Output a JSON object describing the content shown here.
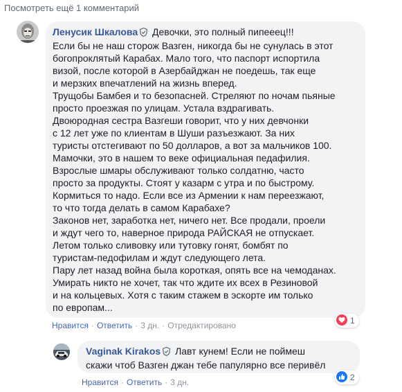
{
  "more_comments": "Посмотреть ещё 1 комментарий",
  "comments": [
    {
      "author": "Ленусик Шкалова",
      "first_line": "Девочки, это полный пипееец!!!",
      "paragraphs": [
        "Если бы не наш сторож Вазген, никогда бы не сунулась в этот\nбогопроклятый Карабах. Мало того, что паспорт испортила\nвизой, после которой в Азербайджан не поедешь, так еще\nи мерзких впечатлений на жизнь вперед.",
        "Трущобы Бамбея и то безопасней. Стреляют по ночам пьяные\nпросто проезжая по улицам. Устала вздрагивать.",
        "Двоюродная сестра Вазгеши говорит, что у них девчонки\nс 12 лет уже по клиентам в Шуши разъезжают. За них\nтуристы отстегивают по 50 долларов, а вот за мальчиков 100.\nМамочки, это в нашем то веке официальная педафилия.",
        "Взрослые шмары обслуживают только солдатню, часто\nпросто за продукты. Стоят у казарм с утра и по быстрому.\nКормиться то надо. Если все из Армении к нам переезжают,\nто что тогда делать в самом Карабахе?",
        "Законов нет, заработка нет, ничего нет. Все продали, проели\nи ждут чего то, наверное природа РАЙСКАЯ не отпускает.",
        "Летом только сливовку или тутовку гонят, бомбят по\nтуристам-педофилам и ждут следующего лета.",
        "Пару лет назад война была короткая, опять все на чемоданах.\nУмирать никто не хочет, так что ждите их всех в Резиновой\nи на кольцевых. Хотя с таким стажем в эскорте им только\nпо европам..."
      ],
      "actions": {
        "like": "Нравится",
        "reply": "Ответить",
        "time": "3 дн.",
        "edited": "Отредактировано"
      },
      "reactions": {
        "count": "1",
        "icon": "love-reaction-icon",
        "color": "#f33e58"
      }
    },
    {
      "author": "Vaginak Kirakos",
      "first_line": "Лавт кунем! Если не поймеш",
      "paragraphs": [
        "скажи чтоб Вазген джан тебе папулярно все перивёл"
      ],
      "actions": {
        "like": "Нравится",
        "reply": "Ответить",
        "time": "3 дн."
      },
      "reactions": {
        "count": "2",
        "icon": "like-reaction-icon",
        "color": "#1877f2"
      }
    }
  ],
  "separator": "·",
  "colors": {
    "link": "#385898",
    "meta": "#90949c",
    "bubble": "#f2f3f5"
  }
}
